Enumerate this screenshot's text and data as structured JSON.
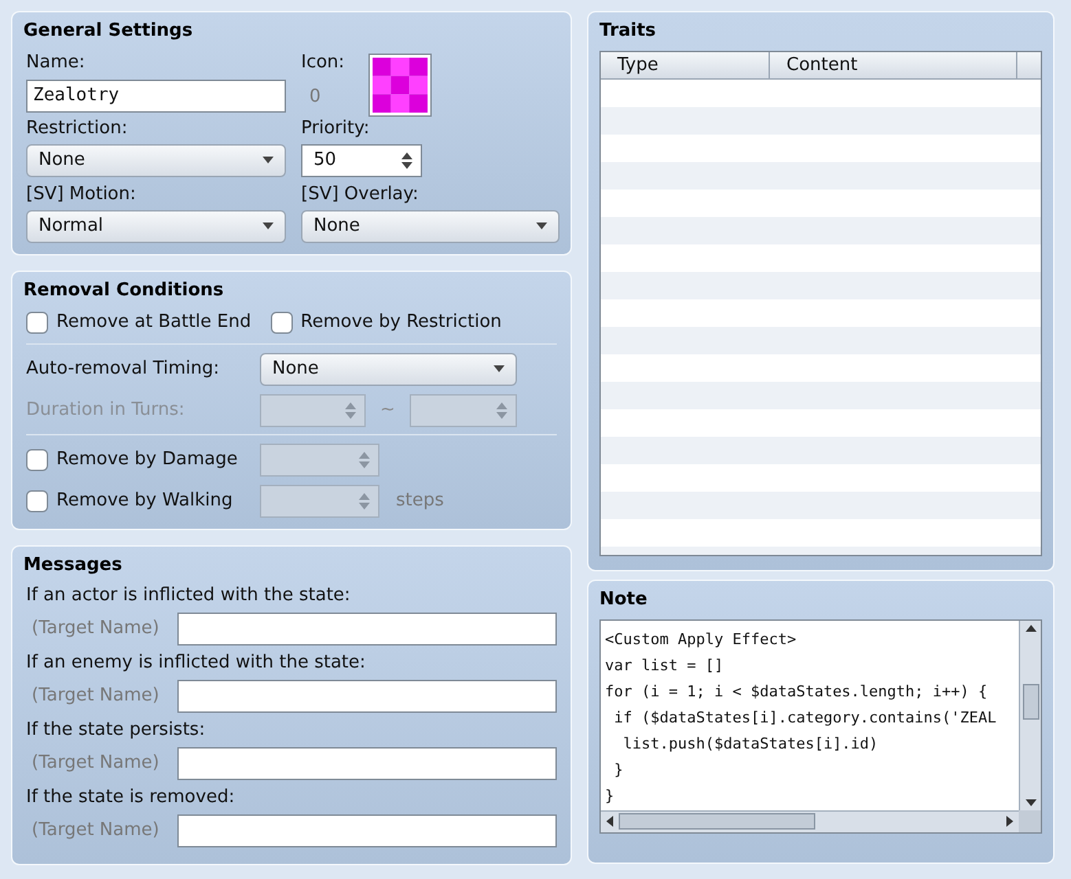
{
  "general": {
    "title": "General Settings",
    "name": {
      "label": "Name:",
      "value": "Zealotry"
    },
    "icon": {
      "label": "Icon:",
      "index": "0"
    },
    "restriction": {
      "label": "Restriction:",
      "value": "None"
    },
    "priority": {
      "label": "Priority:",
      "value": "50"
    },
    "motion": {
      "label": "[SV] Motion:",
      "value": "Normal"
    },
    "overlay": {
      "label": "[SV] Overlay:",
      "value": "None"
    }
  },
  "removal": {
    "title": "Removal Conditions",
    "checks_top": [
      {
        "label": "Remove at Battle End",
        "checked": false
      },
      {
        "label": "Remove by Restriction",
        "checked": false
      }
    ],
    "timing": {
      "label": "Auto-removal Timing:",
      "value": "None"
    },
    "duration": {
      "label": "Duration in Turns:",
      "separator": "~",
      "disabled": true
    },
    "checks_bottom": [
      {
        "label": "Remove by Damage",
        "checked": false,
        "disabled": true
      },
      {
        "label": "Remove by Walking",
        "checked": false,
        "disabled": true,
        "unit": "steps"
      }
    ]
  },
  "messages": {
    "title": "Messages",
    "items": [
      {
        "label": "If an actor is inflicted with the state:",
        "prefix": "(Target Name)"
      },
      {
        "label": "If an enemy is inflicted with the state:",
        "prefix": "(Target Name)"
      },
      {
        "label": "If the state persists:",
        "prefix": "(Target Name)"
      },
      {
        "label": "If the state is removed:",
        "prefix": "(Target Name)"
      }
    ]
  },
  "traits": {
    "title": "Traits",
    "columns": [
      "Type",
      "Content"
    ]
  },
  "note": {
    "title": "Note",
    "lines": [
      "<Custom Apply Effect>",
      "var list = []",
      "for (i = 1; i < $dataStates.length; i++) {",
      " if ($dataStates[i].category.contains('ZEAL",
      "  list.push($dataStates[i].id)",
      " }",
      "}"
    ]
  }
}
